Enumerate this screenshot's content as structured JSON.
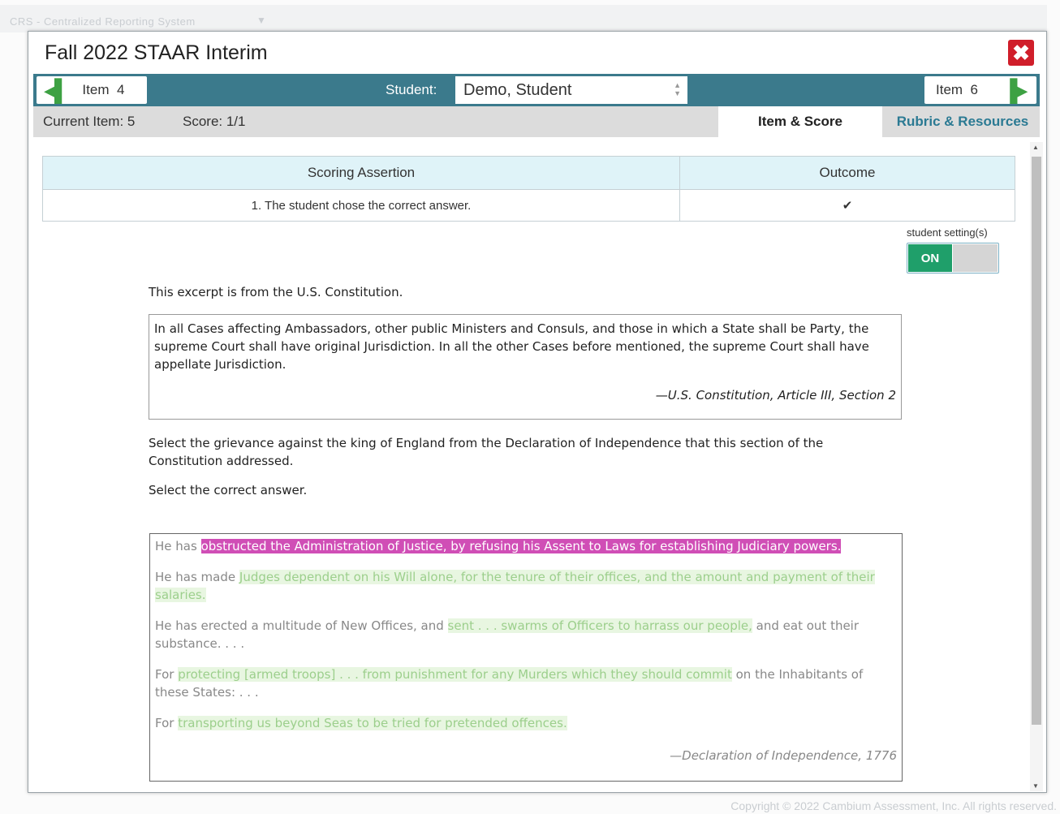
{
  "background": {
    "app_title": "CRS - Centralized Reporting System",
    "copyright": "Copyright © 2022 Cambium Assessment, Inc. All rights reserved."
  },
  "modal": {
    "title": "Fall 2022 STAAR Interim",
    "close_icon": "close-icon"
  },
  "nav": {
    "prev_label": "Item",
    "prev_num": "4",
    "next_label": "Item",
    "next_num": "6",
    "student_label": "Student:",
    "student_value": "Demo, Student"
  },
  "status": {
    "current_item": "Current Item: 5",
    "score": "Score: 1/1"
  },
  "tabs": [
    {
      "label": "Item & Score",
      "active": true
    },
    {
      "label": "Rubric & Resources",
      "active": false
    }
  ],
  "scoring_table": {
    "headers": [
      "Scoring Assertion",
      "Outcome"
    ],
    "rows": [
      {
        "assertion": "1. The student chose the correct answer.",
        "outcome": "✔"
      }
    ]
  },
  "student_settings": {
    "label": "student setting(s)",
    "toggle_on": "ON"
  },
  "item": {
    "intro": "This excerpt is from the U.S. Constitution.",
    "excerpt_text": "In all Cases affecting Ambassadors, other public Ministers and Consuls, and those in which a State shall be Party, the supreme Court shall have original Jurisdiction. In all the other Cases before mentioned, the supreme Court shall have appellate Jurisdiction.",
    "excerpt_cite": "—U.S. Constitution, Article III, Section 2",
    "question": "Select the grievance against the king of England from the Declaration of Independence that this section of the Constitution addressed.",
    "instruction": "Select the correct answer.",
    "options": [
      {
        "prefix": "He has ",
        "highlight": "obstructed the Administration of Justice, by refusing his Assent to Laws for establishing Judiciary powers.",
        "suffix": "",
        "selected": true
      },
      {
        "prefix": "He has made ",
        "highlight": "Judges dependent on his Will alone, for the tenure of their offices, and the amount and payment of their salaries.",
        "suffix": "",
        "selected": false
      },
      {
        "prefix": "He has erected a multitude of New Offices, and ",
        "highlight": "sent . . . swarms of Officers to harrass our people,",
        "suffix": " and eat out their substance. . . .",
        "selected": false
      },
      {
        "prefix": "For ",
        "highlight": "protecting [armed troops] . . . from punishment for any Murders which they should commit",
        "suffix": " on the Inhabitants of these States: . . .",
        "selected": false
      },
      {
        "prefix": "For ",
        "highlight": "transporting us beyond Seas to be tried for pretended offences.",
        "suffix": "",
        "selected": false
      }
    ],
    "options_cite": "—Declaration of Independence, 1776"
  },
  "colors": {
    "nav_bar": "#3b7a8c",
    "accent_green": "#3da143",
    "close_red": "#d01e2a",
    "selected_highlight": "#d04eb6",
    "toggle_on": "#1f9f6a"
  }
}
